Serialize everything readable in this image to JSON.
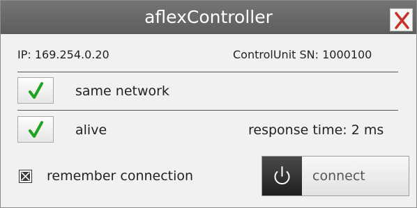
{
  "window": {
    "title": "aflexController"
  },
  "info": {
    "ip": "IP: 169.254.0.20",
    "serial": "ControlUnit SN: 1000100"
  },
  "checks": {
    "same_network": "same network",
    "alive": "alive",
    "response_time": "response time: 2 ms"
  },
  "remember": {
    "label": "remember connection",
    "checked": true
  },
  "connect": {
    "label": "connect"
  },
  "colors": {
    "titlebar": "#6b6b6b",
    "close_x": "#c8312a",
    "check_green": "#1fa31f"
  },
  "icons": {
    "close": "close-icon",
    "check": "checkmark-icon",
    "power": "power-icon"
  }
}
